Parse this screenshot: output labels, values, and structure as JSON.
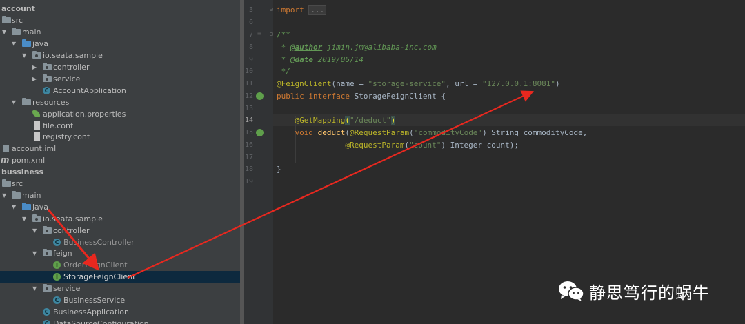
{
  "tree": {
    "items": [
      {
        "label": "account",
        "kind": "module",
        "depth": 0
      },
      {
        "label": "src",
        "kind": "folder",
        "depth": 0
      },
      {
        "label": "main",
        "kind": "folder",
        "depth": 0,
        "expanded": true
      },
      {
        "label": "java",
        "kind": "folder-src",
        "depth": 1,
        "expanded": true
      },
      {
        "label": "io.seata.sample",
        "kind": "package",
        "depth": 2,
        "expanded": true
      },
      {
        "label": "controller",
        "kind": "package",
        "depth": 3,
        "collapsed": true
      },
      {
        "label": "service",
        "kind": "package",
        "depth": 3,
        "collapsed": true
      },
      {
        "label": "AccountApplication",
        "kind": "spring-class",
        "depth": 3
      },
      {
        "label": "resources",
        "kind": "folder",
        "depth": 1,
        "expanded": true
      },
      {
        "label": "application.properties",
        "kind": "properties",
        "depth": 2
      },
      {
        "label": "file.conf",
        "kind": "file",
        "depth": 2
      },
      {
        "label": "registry.conf",
        "kind": "file",
        "depth": 2
      },
      {
        "label": "account.iml",
        "kind": "iml",
        "depth": 0
      },
      {
        "label": "pom.xml",
        "kind": "maven",
        "depth": 0
      },
      {
        "label": "bussiness",
        "kind": "module",
        "depth": 0
      },
      {
        "label": "src",
        "kind": "folder",
        "depth": 0
      },
      {
        "label": "main",
        "kind": "folder",
        "depth": 0,
        "expanded": true
      },
      {
        "label": "java",
        "kind": "folder-src",
        "depth": 1,
        "expanded": true
      },
      {
        "label": "io.seata.sample",
        "kind": "package",
        "depth": 2,
        "expanded": true
      },
      {
        "label": "controller",
        "kind": "package",
        "depth": 3,
        "expanded": true
      },
      {
        "label": "BusinessController",
        "kind": "class",
        "depth": 4
      },
      {
        "label": "feign",
        "kind": "package",
        "depth": 3,
        "expanded": true
      },
      {
        "label": "OrderFeignClient",
        "kind": "interface",
        "depth": 4
      },
      {
        "label": "StorageFeignClient",
        "kind": "interface",
        "depth": 4,
        "selected": true
      },
      {
        "label": "service",
        "kind": "package",
        "depth": 3,
        "expanded": true
      },
      {
        "label": "BusinessService",
        "kind": "class",
        "depth": 4
      },
      {
        "label": "BusinessApplication",
        "kind": "spring-class",
        "depth": 3
      },
      {
        "label": "DataSourceConfiguration",
        "kind": "spring-class",
        "depth": 3
      }
    ]
  },
  "editor": {
    "line_numbers": [
      "3",
      "6",
      "7",
      "8",
      "9",
      "10",
      "11",
      "12",
      "13",
      "14",
      "15",
      "16",
      "17",
      "18",
      "19"
    ],
    "current_line": "14",
    "lines": {
      "l3_kw": "import",
      "l3_dots": "...",
      "l7": "/**",
      "l8_star": " * ",
      "l8_tag": "@author",
      "l8_text": " jimin.jm@alibaba-inc.com",
      "l9_star": " * ",
      "l9_tag": "@date",
      "l9_text": " 2019/06/14",
      "l10": " */",
      "l11_ann": "@FeignClient",
      "l11_p1": "(name = ",
      "l11_s1": "\"storage-service\"",
      "l11_p2": ", url = ",
      "l11_s2": "\"127.0.0.1:8081\"",
      "l11_p3": ")",
      "l12_kw": "public interface ",
      "l12_name": "StorageFeignClient {",
      "l14_ann": "@GetMapping",
      "l14_open": "(",
      "l14_str": "\"/deduct\"",
      "l14_close": ")",
      "l15_kw": "void ",
      "l15_fn": "deduct",
      "l15_p1": "(",
      "l15_ann": "@RequestParam",
      "l15_p2": "(",
      "l15_str": "\"commodityCode\"",
      "l15_p3": ") String commodityCode,",
      "l16_ann": "@RequestParam",
      "l16_p1": "(",
      "l16_str": "\"count\"",
      "l16_p2": ") Integer count);",
      "l18": "}"
    }
  },
  "watermark": {
    "text": "静思笃行的蜗牛",
    "icon": "wechat-icon"
  },
  "colors": {
    "tree_bg": "#3c3f41",
    "editor_bg": "#2b2b2b",
    "selection": "#0d293e",
    "arrow": "#e8281f"
  }
}
